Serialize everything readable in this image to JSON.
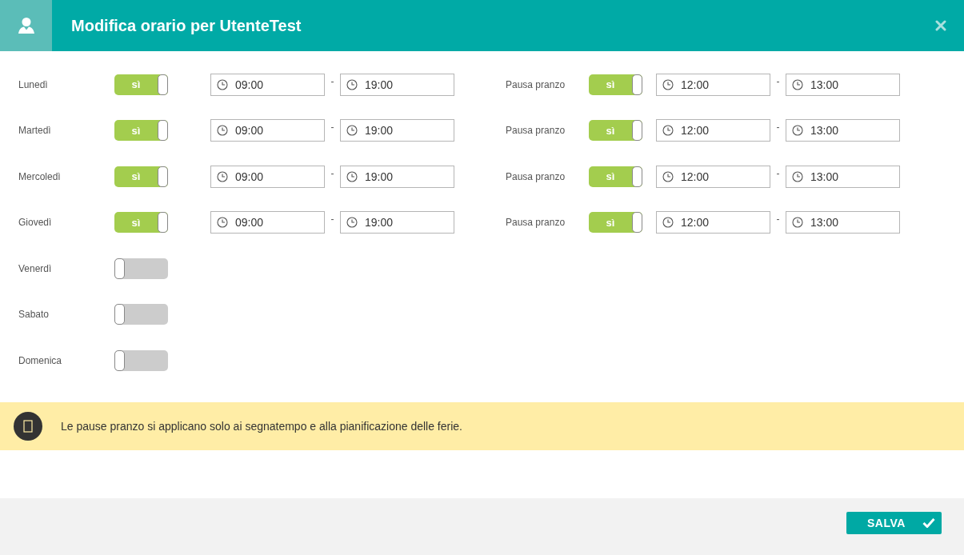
{
  "window": {
    "title": "Modifica orario per UtenteTest"
  },
  "days": [
    {
      "name": "Lunedì",
      "toggle": {
        "on": true,
        "label": "sì"
      },
      "start": "09:00",
      "separator": "-",
      "end": "19:00",
      "lunch": {
        "label": "Pausa pranzo",
        "toggle": {
          "on": true,
          "label": "sì"
        },
        "start": "12:00",
        "separator": "-",
        "end": "13:00"
      }
    },
    {
      "name": "Martedì",
      "toggle": {
        "on": true,
        "label": "sì"
      },
      "start": "09:00",
      "separator": "-",
      "end": "19:00",
      "lunch": {
        "label": "Pausa pranzo",
        "toggle": {
          "on": true,
          "label": "sì"
        },
        "start": "12:00",
        "separator": "-",
        "end": "13:00"
      }
    },
    {
      "name": "Mercoledì",
      "toggle": {
        "on": true,
        "label": "sì"
      },
      "start": "09:00",
      "separator": "-",
      "end": "19:00",
      "lunch": {
        "label": "Pausa pranzo",
        "toggle": {
          "on": true,
          "label": "sì"
        },
        "start": "12:00",
        "separator": "-",
        "end": "13:00"
      }
    },
    {
      "name": "Giovedì",
      "toggle": {
        "on": true,
        "label": "sì"
      },
      "start": "09:00",
      "separator": "-",
      "end": "19:00",
      "lunch": {
        "label": "Pausa pranzo",
        "toggle": {
          "on": true,
          "label": "sì"
        },
        "start": "12:00",
        "separator": "-",
        "end": "13:00"
      }
    },
    {
      "name": "Venerdì",
      "toggle": {
        "on": false
      }
    },
    {
      "name": "Sabato",
      "toggle": {
        "on": false
      }
    },
    {
      "name": "Domenica",
      "toggle": {
        "on": false
      }
    }
  ],
  "notice": {
    "text": "Le pause pranzo si applicano solo ai segnatempo e alla pianificazione delle ferie."
  },
  "footer": {
    "save_button": "SALVA"
  }
}
